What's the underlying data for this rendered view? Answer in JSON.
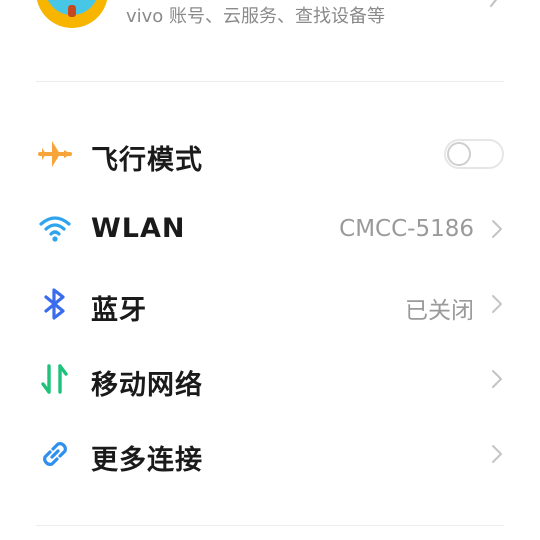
{
  "account": {
    "subtitle": "vivo 账号、云服务、查找设备等"
  },
  "settings": [
    {
      "label": "飞行模式",
      "icon": "airplane-icon",
      "control": "toggle",
      "toggle_on": false
    },
    {
      "label": "WLAN",
      "icon": "wifi-icon",
      "value": "CMCC-5186",
      "control": "chevron"
    },
    {
      "label": "蓝牙",
      "icon": "bluetooth-icon",
      "value": "已关闭",
      "control": "chevron"
    },
    {
      "label": "移动网络",
      "icon": "mobile-network-icon",
      "control": "chevron"
    },
    {
      "label": "更多连接",
      "icon": "link-icon",
      "control": "chevron"
    }
  ],
  "colors": {
    "airplane": "#f7a43a",
    "wifi": "#2fa4ee",
    "bluetooth": "#3b6cf0",
    "mobile_network": "#1fc27a",
    "link": "#2f8fee"
  }
}
